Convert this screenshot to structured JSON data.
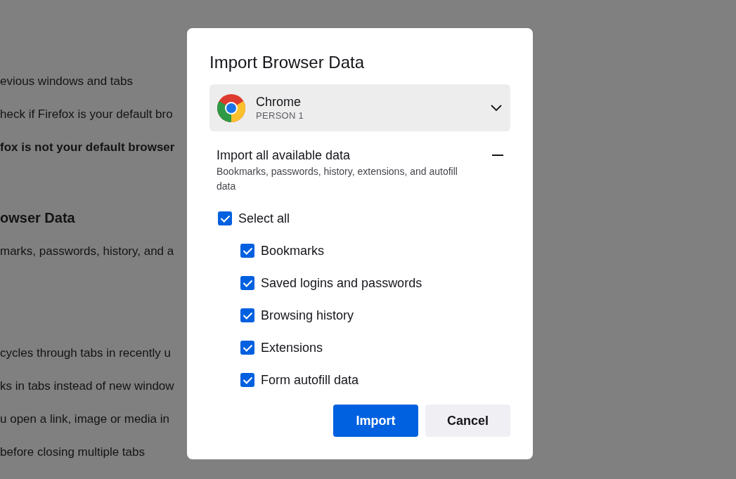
{
  "background_page": {
    "sections": [
      {
        "lines": [
          {
            "kind": "text",
            "text": "evious windows and tabs"
          },
          {
            "kind": "text",
            "text": "heck if Firefox is your default bro"
          },
          {
            "kind": "bold",
            "text": "fox is not your default browser"
          }
        ]
      },
      {
        "lines": [
          {
            "kind": "heading",
            "text": "owser Data"
          },
          {
            "kind": "text",
            "text": "marks, passwords, history, and a"
          }
        ]
      },
      {
        "lines": [
          {
            "kind": "text",
            "text": "cycles through tabs in recently u"
          },
          {
            "kind": "text",
            "text": "ks in tabs instead of new window"
          },
          {
            "kind": "text",
            "text": "u open a link, image or media in"
          },
          {
            "kind": "text",
            "text": "before closing multiple tabs"
          }
        ]
      }
    ]
  },
  "dialog": {
    "title": "Import Browser Data",
    "browser_select": {
      "name": "Chrome",
      "profile": "PERSON 1"
    },
    "import_all": {
      "title": "Import all available data",
      "description": "Bookmarks, passwords, history, extensions, and autofill data",
      "expanded": true
    },
    "select_all": {
      "label": "Select all",
      "checked": true
    },
    "items": [
      {
        "label": "Bookmarks",
        "checked": true
      },
      {
        "label": "Saved logins and passwords",
        "checked": true
      },
      {
        "label": "Browsing history",
        "checked": true
      },
      {
        "label": "Extensions",
        "checked": true
      },
      {
        "label": "Form autofill data",
        "checked": true
      }
    ],
    "buttons": [
      {
        "kind": "primary",
        "label": "Import"
      },
      {
        "kind": "secondary",
        "label": "Cancel"
      }
    ]
  }
}
